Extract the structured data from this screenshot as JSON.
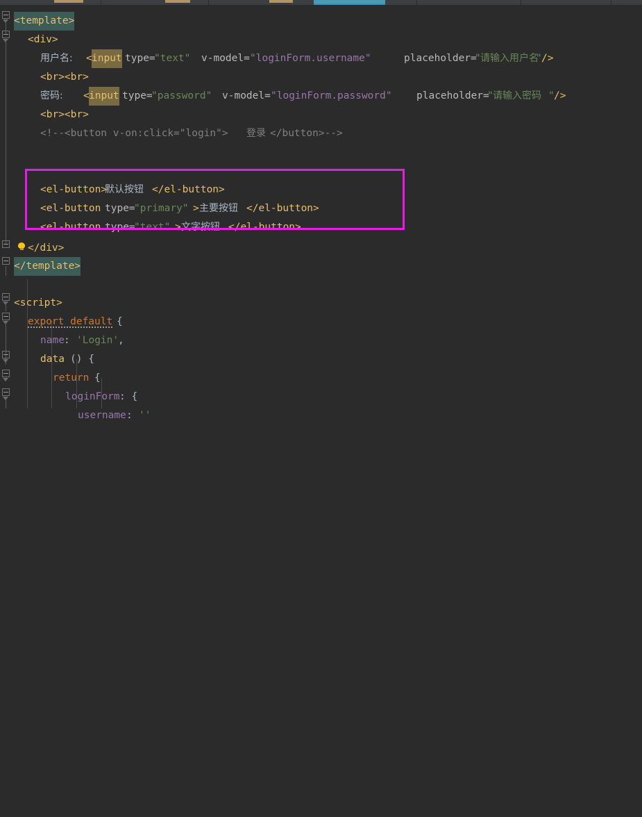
{
  "app": {
    "kind": "code-editor",
    "theme": "darcula",
    "background": "#2b2b2b",
    "language": "vue",
    "annotation_color": "#e81ae8"
  },
  "tabbar": {
    "files": [
      "",
      "",
      ""
    ],
    "active_indicator_color": "#4a9ab0"
  },
  "code_lines": [
    {
      "id": 1,
      "indent": 0,
      "text": "<template>",
      "kind": "tag-selected"
    },
    {
      "id": 2,
      "indent": 1,
      "text": "<div>",
      "kind": "tag"
    },
    {
      "id": 3,
      "indent": 2,
      "text": "用户名:<input type=\"text\" v-model=\"loginForm.username\" placeholder=\"请输入用户名\"/>",
      "kind": "mixed"
    },
    {
      "id": 4,
      "indent": 2,
      "text": "<br><br>",
      "kind": "tag"
    },
    {
      "id": 5,
      "indent": 2,
      "text": "密码:  <input type=\"password\" v-model=\"loginForm.password\" placeholder=\"请输入密码\"/>",
      "kind": "mixed"
    },
    {
      "id": 6,
      "indent": 2,
      "text": "<br><br>",
      "kind": "tag"
    },
    {
      "id": 7,
      "indent": 2,
      "text": "<!--<button v-on:click=\"login\">登录</button>-->",
      "kind": "comment"
    },
    {
      "id": 8,
      "indent": 0,
      "text": "",
      "kind": "blank"
    },
    {
      "id": 9,
      "indent": 0,
      "text": "",
      "kind": "blank"
    },
    {
      "id": 10,
      "indent": 2,
      "text": "<el-button>默认按钮</el-button>",
      "kind": "tag",
      "boxed": true
    },
    {
      "id": 11,
      "indent": 2,
      "text": "<el-button type=\"primary\">主要按钮</el-button>",
      "kind": "tag",
      "boxed": true
    },
    {
      "id": 12,
      "indent": 2,
      "text": "<el-button type=\"text\">文字按钮</el-button>",
      "kind": "tag",
      "boxed": true
    },
    {
      "id": 13,
      "indent": 1,
      "text": "</div>",
      "kind": "tag",
      "bulb": true
    },
    {
      "id": 14,
      "indent": 0,
      "text": "</template>",
      "kind": "tag-selected"
    },
    {
      "id": 15,
      "indent": 0,
      "text": "",
      "kind": "blank"
    },
    {
      "id": 16,
      "indent": 0,
      "text": "<script>",
      "kind": "tag"
    },
    {
      "id": 17,
      "indent": 1,
      "text": "export default {",
      "kind": "keyword-underlined"
    },
    {
      "id": 18,
      "indent": 2,
      "text": "name: 'Login',",
      "kind": "property"
    },
    {
      "id": 19,
      "indent": 2,
      "text": "data () {",
      "kind": "keyword"
    },
    {
      "id": 20,
      "indent": 3,
      "text": "return {",
      "kind": "keyword"
    },
    {
      "id": 21,
      "indent": 4,
      "text": "loginForm: {",
      "kind": "property"
    },
    {
      "id": 22,
      "indent": 5,
      "text": "username: ''",
      "kind": "property"
    }
  ],
  "tokens": {
    "username_label": "用户名:",
    "password_label": "密码:",
    "placeholder_username": "请输入用户名",
    "placeholder_password": "请输入密码",
    "login_text": "登录",
    "default_button": "默认按钮",
    "primary_button": "主要按钮",
    "text_button": "文字按钮",
    "component_name": "Login",
    "data_model": "loginForm",
    "field_username": "username",
    "field_password": "password"
  },
  "annotation": {
    "label": "highlight-box",
    "color": "#e81ae8",
    "covers_lines": [
      "<el-button>默认按钮</el-button>",
      "<el-button type=\"primary\">主要按钮</el-button>",
      "<el-button type=\"text\">文字按钮</el-button>"
    ]
  },
  "gutter": {
    "fold_markers": 8,
    "bulb_hint": "intention-bulb"
  }
}
